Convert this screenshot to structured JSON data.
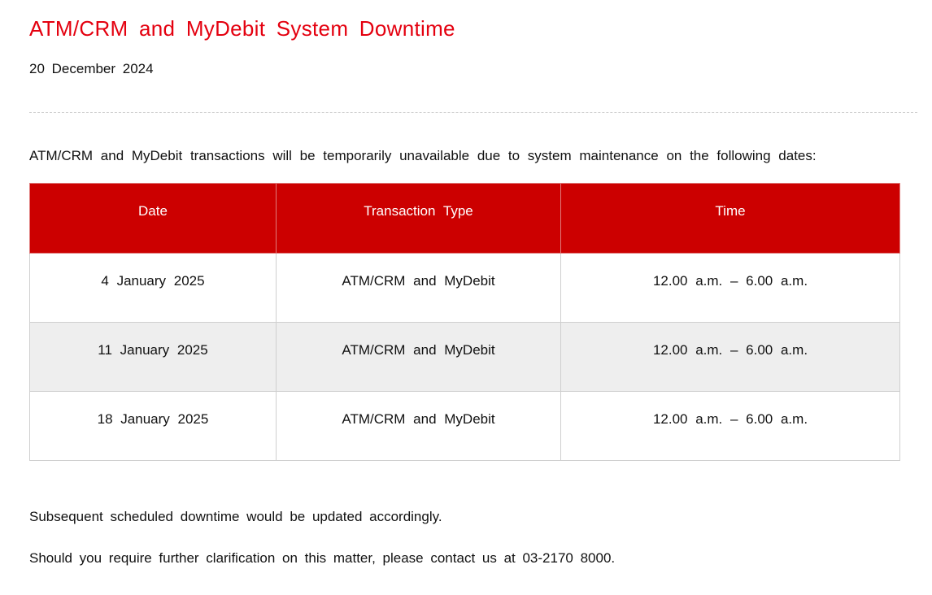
{
  "notice": {
    "title": "ATM/CRM and MyDebit System Downtime",
    "date": "20 December 2024",
    "intro": "ATM/CRM and MyDebit transactions will be temporarily unavailable due to system maintenance on the following dates:",
    "table": {
      "headers": [
        "Date",
        "Transaction Type",
        "Time"
      ],
      "rows": [
        [
          "4 January 2025",
          "ATM/CRM and MyDebit",
          "12.00 a.m. – 6.00 a.m."
        ],
        [
          "11 January 2025",
          "ATM/CRM and MyDebit",
          "12.00 a.m. – 6.00 a.m."
        ],
        [
          "18 January 2025",
          "ATM/CRM and MyDebit",
          "12.00 a.m. – 6.00 a.m."
        ]
      ]
    },
    "footer_note_1": "Subsequent scheduled downtime would be updated accordingly.",
    "footer_note_2": "Should you require further clarification on this matter, please contact us at 03-2170 8000."
  },
  "colors": {
    "title_red": "#e4000f",
    "header_red": "#cc0000",
    "alt_row_gray": "#eeeeee"
  }
}
